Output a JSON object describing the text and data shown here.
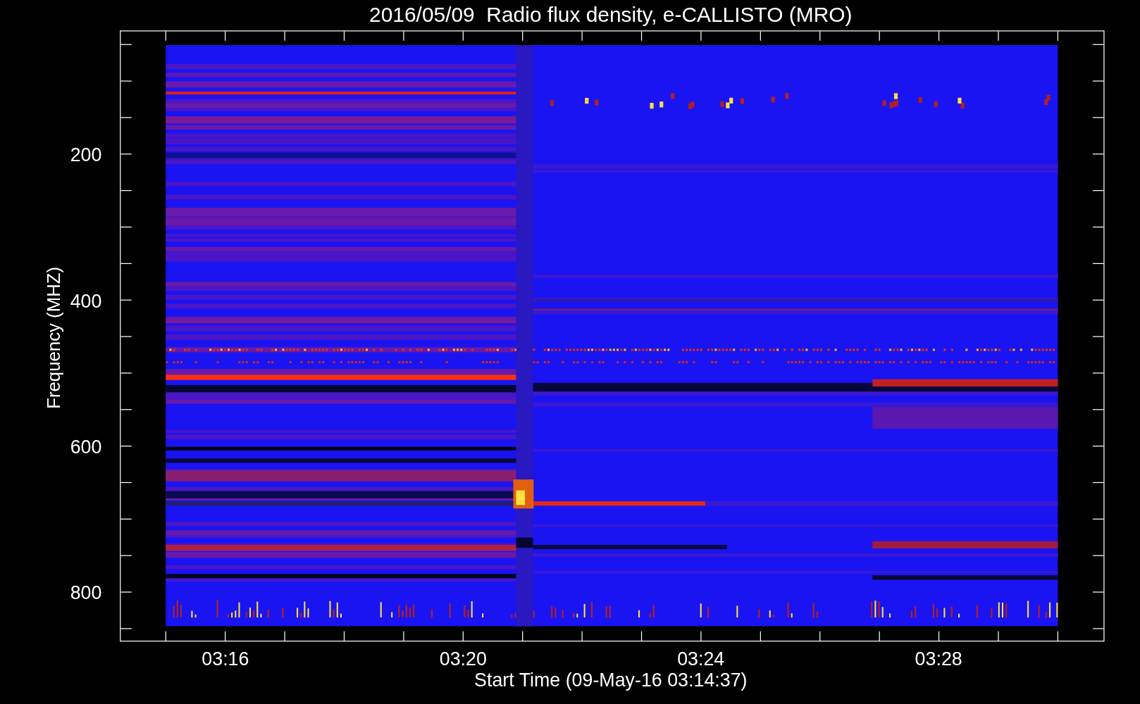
{
  "title": "2016/05/09  Radio flux density, e-CALLISTO (MRO)",
  "y_axis": {
    "label": "Frequency (MHZ)",
    "ticks": [
      "200",
      "400",
      "600",
      "800"
    ]
  },
  "x_axis": {
    "label": "Start Time (09-May-16 03:14:37)",
    "ticks": [
      "03:16",
      "03:20",
      "03:24",
      "03:28"
    ]
  }
}
